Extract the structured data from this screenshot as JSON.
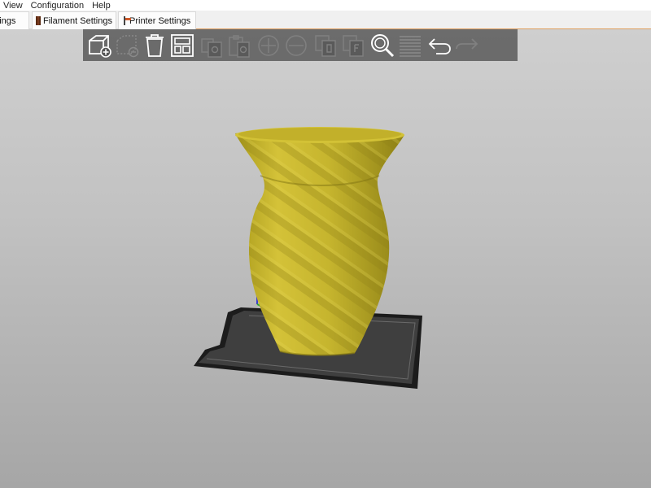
{
  "menubar": {
    "items": [
      {
        "label": "View"
      },
      {
        "label": "Configuration"
      },
      {
        "label": "Help"
      }
    ]
  },
  "tabs": [
    {
      "label": "ettings",
      "icon": "print-settings-icon"
    },
    {
      "label": "Filament Settings",
      "icon": "filament-spool-icon"
    },
    {
      "label": "Printer Settings",
      "icon": "printer-icon"
    }
  ],
  "toolbar": {
    "buttons": [
      {
        "name": "add-object",
        "icon": "add-cube-icon",
        "enabled": true
      },
      {
        "name": "delete",
        "icon": "delete-icon",
        "enabled": false
      },
      {
        "name": "delete-all",
        "icon": "trash-icon",
        "enabled": true
      },
      {
        "name": "arrange",
        "icon": "arrange-icon",
        "enabled": true
      },
      {
        "name": "copy",
        "icon": "copy-icon",
        "enabled": false
      },
      {
        "name": "paste",
        "icon": "paste-icon",
        "enabled": false
      },
      {
        "name": "add-instance",
        "icon": "plus-circle-icon",
        "enabled": false
      },
      {
        "name": "remove-instance",
        "icon": "minus-circle-icon",
        "enabled": false
      },
      {
        "name": "split-objects",
        "icon": "split-objects-icon",
        "enabled": false
      },
      {
        "name": "split-parts",
        "icon": "split-parts-icon",
        "enabled": false
      },
      {
        "name": "search",
        "icon": "search-icon",
        "enabled": true
      },
      {
        "name": "layers-editing",
        "icon": "layers-icon",
        "enabled": false
      },
      {
        "name": "undo",
        "icon": "undo-icon",
        "enabled": true
      },
      {
        "name": "redo",
        "icon": "redo-icon",
        "enabled": false
      }
    ]
  },
  "scene": {
    "object": "vase-model",
    "object_color": "#c9b832",
    "bed_color": "#3f3f3f",
    "bed_border_color": "#1c1c1c",
    "background_top": "#cfcfcf",
    "background_bottom": "#a6a6a6"
  }
}
